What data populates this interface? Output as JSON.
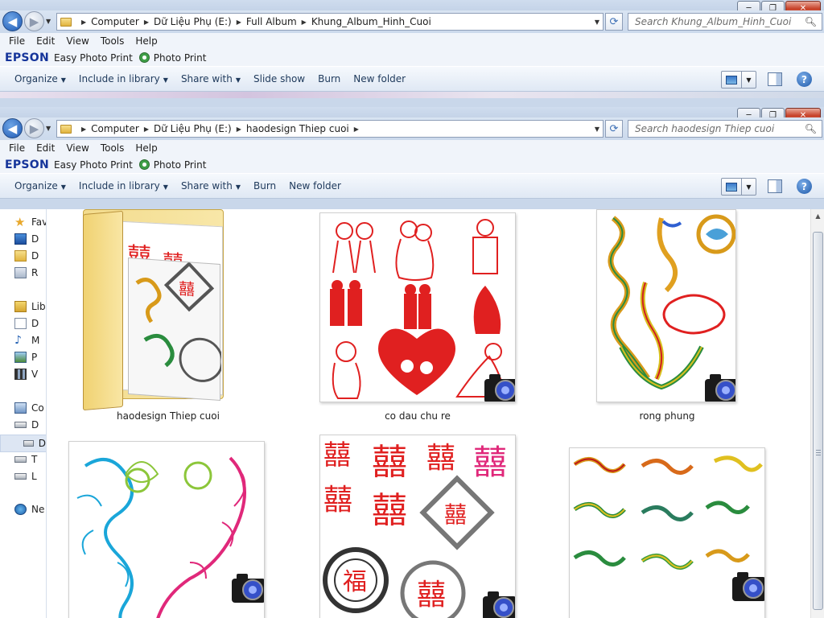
{
  "back_window": {
    "breadcrumbs": [
      "Computer",
      "Dữ Liệu Phụ (E:)",
      "Full Album",
      "Khung_Album_Hinh_Cuoi"
    ],
    "search_placeholder": "Search Khung_Album_Hinh_Cuoi",
    "menu": [
      "File",
      "Edit",
      "View",
      "Tools",
      "Help"
    ],
    "epson": {
      "logo": "EPSON",
      "easy": "Easy Photo Print",
      "photo": "Photo Print"
    },
    "commands": [
      {
        "label": "Organize",
        "dropdown": true
      },
      {
        "label": "Include in library",
        "dropdown": true
      },
      {
        "label": "Share with",
        "dropdown": true
      },
      {
        "label": "Slide show",
        "dropdown": false
      },
      {
        "label": "Burn",
        "dropdown": false
      },
      {
        "label": "New folder",
        "dropdown": false
      }
    ]
  },
  "front_window": {
    "breadcrumbs": [
      "Computer",
      "Dữ Liệu Phụ (E:)",
      "haodesign Thiep cuoi"
    ],
    "search_placeholder": "Search haodesign Thiep cuoi",
    "menu": [
      "File",
      "Edit",
      "View",
      "Tools",
      "Help"
    ],
    "epson": {
      "logo": "EPSON",
      "easy": "Easy Photo Print",
      "photo": "Photo Print"
    },
    "commands": [
      {
        "label": "Organize",
        "dropdown": true
      },
      {
        "label": "Include in library",
        "dropdown": true
      },
      {
        "label": "Share with",
        "dropdown": true
      },
      {
        "label": "Burn",
        "dropdown": false
      },
      {
        "label": "New folder",
        "dropdown": false
      }
    ],
    "nav_pane": [
      {
        "label": "Fav",
        "icon": "star-icon"
      },
      {
        "label": "D",
        "icon": "desktop-icon"
      },
      {
        "label": "D",
        "icon": "downloads-icon"
      },
      {
        "label": "R",
        "icon": "recent-places-icon"
      },
      {
        "label": "Libr",
        "icon": "library-icon"
      },
      {
        "label": "D",
        "icon": "documents-icon"
      },
      {
        "label": "M",
        "icon": "music-icon"
      },
      {
        "label": "P",
        "icon": "pictures-icon"
      },
      {
        "label": "V",
        "icon": "videos-icon"
      },
      {
        "label": "Co",
        "icon": "computer-icon"
      },
      {
        "label": "D",
        "icon": "drive-icon"
      },
      {
        "label": "D",
        "icon": "drive-icon"
      },
      {
        "label": "T",
        "icon": "drive-icon"
      },
      {
        "label": "L",
        "icon": "drive-icon"
      },
      {
        "label": "Ne",
        "icon": "network-icon"
      }
    ],
    "files": [
      {
        "name": "haodesign Thiep cuoi",
        "type": "folder"
      },
      {
        "name": "co dau chu re",
        "type": "image"
      },
      {
        "name": "rong phung",
        "type": "image"
      },
      {
        "name": "",
        "type": "image"
      },
      {
        "name": "",
        "type": "image"
      },
      {
        "name": "",
        "type": "image"
      }
    ]
  },
  "glyphs": {
    "double_happiness": "囍",
    "fortune": "福",
    "minimize": "─",
    "maximize": "❐",
    "close": "✕",
    "back": "◀",
    "forward": "▶",
    "refresh": "⟳",
    "search": "⚲",
    "help": "?"
  },
  "colors": {
    "accent_red": "#e02020",
    "pink": "#e0287a",
    "dragon_gold": "#d89a1a",
    "cyan_dragon": "#1aa6d9",
    "folder_yellow": "#f3dc8e"
  }
}
